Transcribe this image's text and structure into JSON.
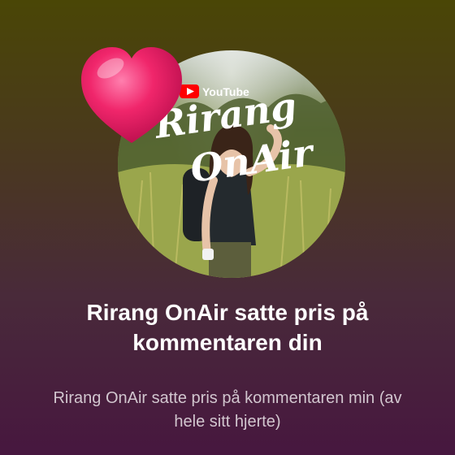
{
  "notification": {
    "channel_name": "Rirang OnAir",
    "title": "Rirang OnAir satte pris på kommentaren din",
    "subtitle": "Rirang OnAir satte pris på kommentaren min (av hele sitt hjerte)"
  },
  "avatar_overlay": {
    "brand_text": "YouTube",
    "channel_text_line1": "Rirang",
    "channel_text_line2": "OnAir"
  },
  "icons": {
    "heart": "heart-icon",
    "youtube_logo": "youtube-logo-icon"
  },
  "colors": {
    "heart": "#f0266b",
    "title_text": "#ffffff",
    "subtitle_text": "#d2c6cf",
    "gradient_top": "#4a4606",
    "gradient_bottom": "#47173f"
  }
}
